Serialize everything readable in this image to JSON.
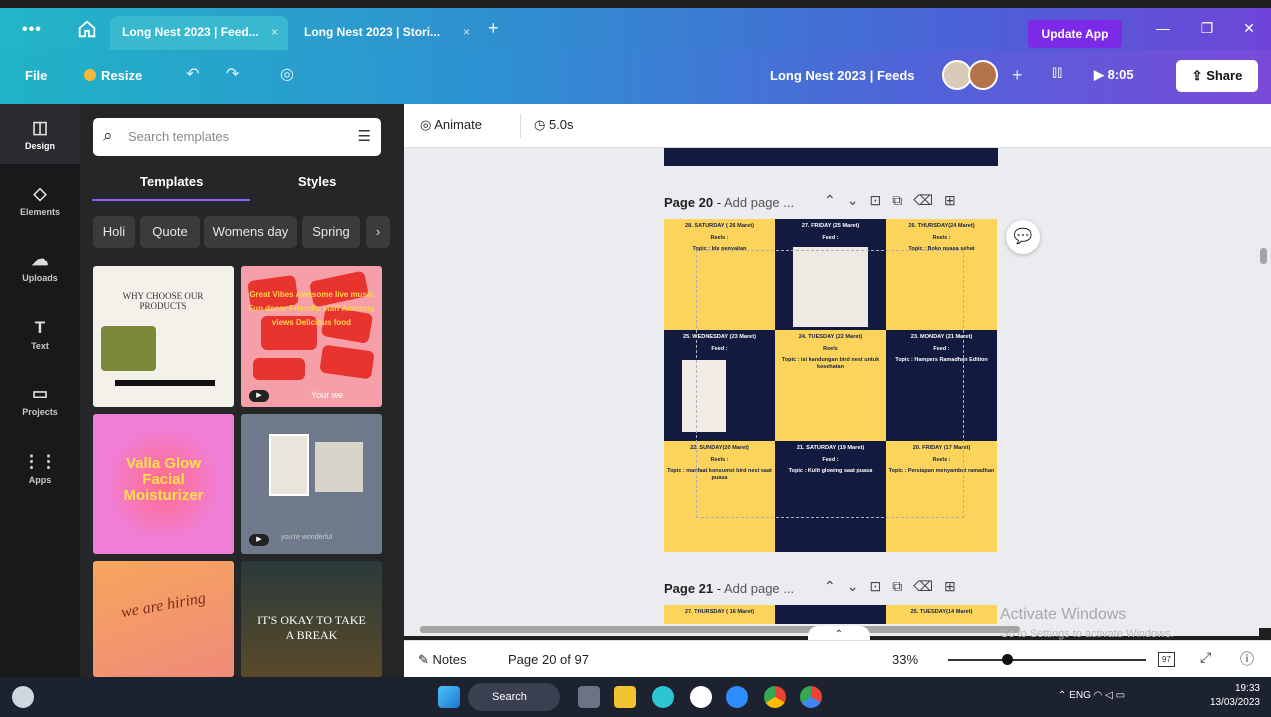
{
  "titlebar": {
    "tabs": [
      {
        "label": "Long Nest 2023 | Feed...",
        "close": "×"
      },
      {
        "label": "Long Nest 2023 | Stori...",
        "close": "×"
      }
    ],
    "new_tab": "+",
    "update_app": "Update App"
  },
  "toolbar": {
    "file": "File",
    "resize": "Resize",
    "doc_title": "Long Nest 2023 | Feeds",
    "add_collab": "+",
    "play_time": "8:05",
    "share": "Share"
  },
  "rail": [
    {
      "label": "Design",
      "icon": "layout-icon",
      "glyph": "◫"
    },
    {
      "label": "Elements",
      "icon": "shapes-icon",
      "glyph": "◇"
    },
    {
      "label": "Uploads",
      "icon": "cloud-upload-icon",
      "glyph": "☁"
    },
    {
      "label": "Text",
      "icon": "text-icon",
      "glyph": "T"
    },
    {
      "label": "Projects",
      "icon": "folder-icon",
      "glyph": "▭"
    },
    {
      "label": "Apps",
      "icon": "grid-icon",
      "glyph": "⋮⋮"
    }
  ],
  "panel": {
    "search_placeholder": "Search templates",
    "tabs": [
      "Templates",
      "Styles"
    ],
    "chips": [
      "Holi",
      "Quote",
      "Womens day",
      "Spring"
    ],
    "thumbs": [
      {
        "text": "WHY CHOOSE OUR PRODUCTS"
      },
      {
        "text": "Great Vibes  Awesome live music  Fun decor  Friendly staff  Amazing views  Delicious food",
        "sub": "Your we"
      },
      {
        "text": "Valla Glow Facial Moisturizer"
      },
      {
        "text": "you're wonderful"
      },
      {
        "text": "we are hiring"
      },
      {
        "text": "IT'S OKAY TO TAKE A BREAK"
      }
    ]
  },
  "canvasbar": {
    "animate": "Animate",
    "duration": "5.0s"
  },
  "pages": [
    {
      "number": "Page 20",
      "add": "Add page ...",
      "cells": [
        {
          "day": "28. SATURDAY ( 26 Maret)",
          "line1": "Reels :",
          "line2": "Topic : Ide penyajian"
        },
        {
          "day": "27. FRIDAY (25 Maret)",
          "line1": "Feed :",
          "line2": ""
        },
        {
          "day": "26. THURSDAY(24 Maret)",
          "line1": "Reels :",
          "line2": "Topic : Boko puasa sehat"
        },
        {
          "day": "25. WEDNESDAY (23 Maret)",
          "line1": "Feed :",
          "line2": ""
        },
        {
          "day": "24. TUESDAY (22 Maret)",
          "line1": "Reels",
          "line2": "Topic : isi kandungan bird nest untuk kesehatan"
        },
        {
          "day": "23. MONDAY (21 Maret)",
          "line1": "Feed :",
          "line2": "Topic : Hampers Ramadhan Edition"
        },
        {
          "day": "22. SUNDAY(20 Maret)",
          "line1": "Reels :",
          "line2": "Topic : manfaat konsumsi bird nest saat puasa"
        },
        {
          "day": "21. SATURDAY (19 Maret)",
          "line1": "Feed :",
          "line2": "Topic : Kulit glowing saat puasa"
        },
        {
          "day": "20. FRIDAY (17 Maret)",
          "line1": "Reels :",
          "line2": "Topic : Persiapan menyambut ramadhan"
        }
      ]
    },
    {
      "number": "Page 21",
      "add": "Add page ...",
      "cells": [
        {
          "day": "27. THURSDAY ( 16 Maret)"
        },
        {
          "day": ""
        },
        {
          "day": "25. TUESDAY(14 Maret)"
        }
      ]
    }
  ],
  "watermark": {
    "line1": "Activate Windows",
    "line2": "Go to Settings to activate Windows."
  },
  "footer": {
    "notes": "Notes",
    "page": "Page 20 of 97",
    "zoom": "33%",
    "zoom_level": 0.33,
    "grid_badge": "97"
  },
  "taskbar": {
    "search": "Search",
    "lang": "ENG",
    "time": "19:33",
    "date": "13/03/2023"
  },
  "colors": {
    "accent": "#7d2ae8",
    "cell_yellow": "#fcd45c",
    "cell_navy": "#131a40"
  }
}
